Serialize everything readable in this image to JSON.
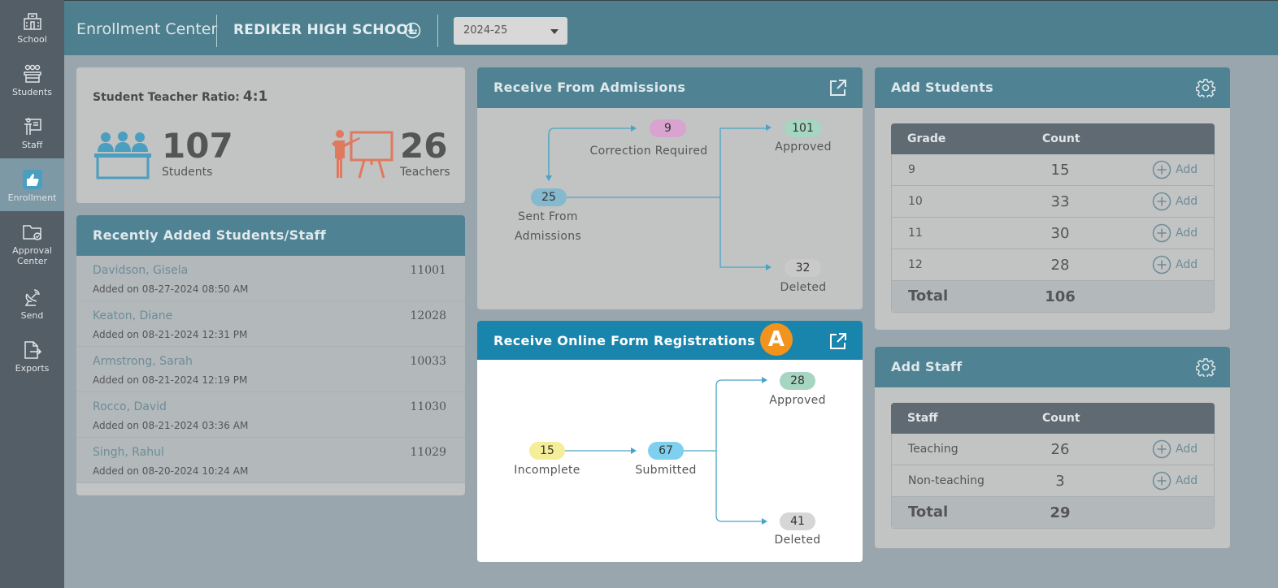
{
  "sidebar": {
    "items": [
      {
        "label": "School",
        "icon": "school-icon"
      },
      {
        "label": "Students",
        "icon": "students-icon"
      },
      {
        "label": "Staff",
        "icon": "staff-icon"
      },
      {
        "label": "Enrollment",
        "icon": "thumbs-up-icon",
        "active": true
      },
      {
        "label": "Approval Center",
        "icon": "folder-check-icon"
      },
      {
        "label": "Send",
        "icon": "satellite-dish-icon"
      },
      {
        "label": "Exports",
        "icon": "file-export-icon"
      }
    ]
  },
  "header": {
    "title": "Enrollment Center",
    "school": "REDIKER HIGH SCHOOL",
    "year": "2024-25"
  },
  "ratio": {
    "label": "Student Teacher Ratio:",
    "value": "4:1",
    "students_count": "107",
    "students_label": "Students",
    "teachers_count": "26",
    "teachers_label": "Teachers"
  },
  "recent": {
    "title": "Recently Added Students/Staff",
    "items": [
      {
        "name": "Davidson, Gisela",
        "id": "11001",
        "date": "Added on 08-27-2024 08:50 AM"
      },
      {
        "name": "Keaton, Diane",
        "id": "12028",
        "date": "Added on 08-21-2024 12:31 PM"
      },
      {
        "name": "Armstrong, Sarah",
        "id": "10033",
        "date": "Added on 08-21-2024 12:19 PM"
      },
      {
        "name": "Rocco, David",
        "id": "11030",
        "date": "Added on 08-21-2024 03:36 AM"
      },
      {
        "name": "Singh, Rahul",
        "id": "11029",
        "date": "Added on 08-20-2024 10:24 AM"
      }
    ]
  },
  "admissions": {
    "title": "Receive From Admissions",
    "correction": {
      "count": "9",
      "label": "Correction Required"
    },
    "approved": {
      "count": "101",
      "label": "Approved"
    },
    "sent": {
      "count": "25",
      "label_line1": "Sent From",
      "label_line2": "Admissions"
    },
    "deleted": {
      "count": "32",
      "label": "Deleted"
    }
  },
  "online": {
    "title": "Receive Online Form Registrations",
    "badge": "A",
    "incomplete": {
      "count": "15",
      "label": "Incomplete"
    },
    "submitted": {
      "count": "67",
      "label": "Submitted"
    },
    "approved": {
      "count": "28",
      "label": "Approved"
    },
    "deleted": {
      "count": "41",
      "label": "Deleted"
    }
  },
  "add_students": {
    "title": "Add Students",
    "col_grade": "Grade",
    "col_count": "Count",
    "add_label": "Add",
    "rows": [
      {
        "grade": "9",
        "count": "15"
      },
      {
        "grade": "10",
        "count": "33"
      },
      {
        "grade": "11",
        "count": "30"
      },
      {
        "grade": "12",
        "count": "28"
      }
    ],
    "total_label": "Total",
    "total": "106"
  },
  "add_staff": {
    "title": "Add Staff",
    "col_staff": "Staff",
    "col_count": "Count",
    "add_label": "Add",
    "rows": [
      {
        "type": "Teaching",
        "count": "26"
      },
      {
        "type": "Non-teaching",
        "count": "3"
      }
    ],
    "total_label": "Total",
    "total": "29"
  },
  "colors": {
    "header": "#4d7f8f",
    "sidebar": "#545e66",
    "badge": "#f2931e",
    "arrow": "#4aa4c6",
    "pill_correction": "#d9a3cf",
    "pill_approved": "#a6d5c1",
    "pill_sent": "#84b9cf",
    "pill_deleted": "#c9c9c9",
    "pill_incomplete": "#f4ee99",
    "pill_submitted": "#7ed0ee"
  }
}
